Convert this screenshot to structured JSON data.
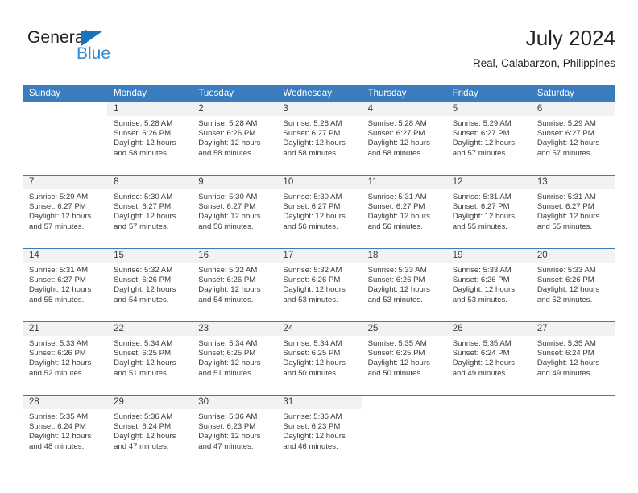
{
  "brand": {
    "name_part1": "General",
    "name_part2": "Blue",
    "triangle_icon": "triangle-icon",
    "accent_color": "#2e8bd4",
    "triangle_color": "#1a74bb"
  },
  "header": {
    "month_title": "July 2024",
    "location": "Real, Calabarzon, Philippines"
  },
  "theme": {
    "header_bar_color": "#3a7cbe",
    "daynum_strip_color": "#f2f2f2",
    "text_color": "#3b3b3b"
  },
  "calendar": {
    "weekday_headers": [
      "Sunday",
      "Monday",
      "Tuesday",
      "Wednesday",
      "Thursday",
      "Friday",
      "Saturday"
    ],
    "weeks": [
      [
        {
          "day": "",
          "sunrise": "",
          "sunset": "",
          "daylight_line1": "",
          "daylight_line2": ""
        },
        {
          "day": "1",
          "sunrise": "Sunrise: 5:28 AM",
          "sunset": "Sunset: 6:26 PM",
          "daylight_line1": "Daylight: 12 hours",
          "daylight_line2": "and 58 minutes."
        },
        {
          "day": "2",
          "sunrise": "Sunrise: 5:28 AM",
          "sunset": "Sunset: 6:26 PM",
          "daylight_line1": "Daylight: 12 hours",
          "daylight_line2": "and 58 minutes."
        },
        {
          "day": "3",
          "sunrise": "Sunrise: 5:28 AM",
          "sunset": "Sunset: 6:27 PM",
          "daylight_line1": "Daylight: 12 hours",
          "daylight_line2": "and 58 minutes."
        },
        {
          "day": "4",
          "sunrise": "Sunrise: 5:28 AM",
          "sunset": "Sunset: 6:27 PM",
          "daylight_line1": "Daylight: 12 hours",
          "daylight_line2": "and 58 minutes."
        },
        {
          "day": "5",
          "sunrise": "Sunrise: 5:29 AM",
          "sunset": "Sunset: 6:27 PM",
          "daylight_line1": "Daylight: 12 hours",
          "daylight_line2": "and 57 minutes."
        },
        {
          "day": "6",
          "sunrise": "Sunrise: 5:29 AM",
          "sunset": "Sunset: 6:27 PM",
          "daylight_line1": "Daylight: 12 hours",
          "daylight_line2": "and 57 minutes."
        }
      ],
      [
        {
          "day": "7",
          "sunrise": "Sunrise: 5:29 AM",
          "sunset": "Sunset: 6:27 PM",
          "daylight_line1": "Daylight: 12 hours",
          "daylight_line2": "and 57 minutes."
        },
        {
          "day": "8",
          "sunrise": "Sunrise: 5:30 AM",
          "sunset": "Sunset: 6:27 PM",
          "daylight_line1": "Daylight: 12 hours",
          "daylight_line2": "and 57 minutes."
        },
        {
          "day": "9",
          "sunrise": "Sunrise: 5:30 AM",
          "sunset": "Sunset: 6:27 PM",
          "daylight_line1": "Daylight: 12 hours",
          "daylight_line2": "and 56 minutes."
        },
        {
          "day": "10",
          "sunrise": "Sunrise: 5:30 AM",
          "sunset": "Sunset: 6:27 PM",
          "daylight_line1": "Daylight: 12 hours",
          "daylight_line2": "and 56 minutes."
        },
        {
          "day": "11",
          "sunrise": "Sunrise: 5:31 AM",
          "sunset": "Sunset: 6:27 PM",
          "daylight_line1": "Daylight: 12 hours",
          "daylight_line2": "and 56 minutes."
        },
        {
          "day": "12",
          "sunrise": "Sunrise: 5:31 AM",
          "sunset": "Sunset: 6:27 PM",
          "daylight_line1": "Daylight: 12 hours",
          "daylight_line2": "and 55 minutes."
        },
        {
          "day": "13",
          "sunrise": "Sunrise: 5:31 AM",
          "sunset": "Sunset: 6:27 PM",
          "daylight_line1": "Daylight: 12 hours",
          "daylight_line2": "and 55 minutes."
        }
      ],
      [
        {
          "day": "14",
          "sunrise": "Sunrise: 5:31 AM",
          "sunset": "Sunset: 6:27 PM",
          "daylight_line1": "Daylight: 12 hours",
          "daylight_line2": "and 55 minutes."
        },
        {
          "day": "15",
          "sunrise": "Sunrise: 5:32 AM",
          "sunset": "Sunset: 6:26 PM",
          "daylight_line1": "Daylight: 12 hours",
          "daylight_line2": "and 54 minutes."
        },
        {
          "day": "16",
          "sunrise": "Sunrise: 5:32 AM",
          "sunset": "Sunset: 6:26 PM",
          "daylight_line1": "Daylight: 12 hours",
          "daylight_line2": "and 54 minutes."
        },
        {
          "day": "17",
          "sunrise": "Sunrise: 5:32 AM",
          "sunset": "Sunset: 6:26 PM",
          "daylight_line1": "Daylight: 12 hours",
          "daylight_line2": "and 53 minutes."
        },
        {
          "day": "18",
          "sunrise": "Sunrise: 5:33 AM",
          "sunset": "Sunset: 6:26 PM",
          "daylight_line1": "Daylight: 12 hours",
          "daylight_line2": "and 53 minutes."
        },
        {
          "day": "19",
          "sunrise": "Sunrise: 5:33 AM",
          "sunset": "Sunset: 6:26 PM",
          "daylight_line1": "Daylight: 12 hours",
          "daylight_line2": "and 53 minutes."
        },
        {
          "day": "20",
          "sunrise": "Sunrise: 5:33 AM",
          "sunset": "Sunset: 6:26 PM",
          "daylight_line1": "Daylight: 12 hours",
          "daylight_line2": "and 52 minutes."
        }
      ],
      [
        {
          "day": "21",
          "sunrise": "Sunrise: 5:33 AM",
          "sunset": "Sunset: 6:26 PM",
          "daylight_line1": "Daylight: 12 hours",
          "daylight_line2": "and 52 minutes."
        },
        {
          "day": "22",
          "sunrise": "Sunrise: 5:34 AM",
          "sunset": "Sunset: 6:25 PM",
          "daylight_line1": "Daylight: 12 hours",
          "daylight_line2": "and 51 minutes."
        },
        {
          "day": "23",
          "sunrise": "Sunrise: 5:34 AM",
          "sunset": "Sunset: 6:25 PM",
          "daylight_line1": "Daylight: 12 hours",
          "daylight_line2": "and 51 minutes."
        },
        {
          "day": "24",
          "sunrise": "Sunrise: 5:34 AM",
          "sunset": "Sunset: 6:25 PM",
          "daylight_line1": "Daylight: 12 hours",
          "daylight_line2": "and 50 minutes."
        },
        {
          "day": "25",
          "sunrise": "Sunrise: 5:35 AM",
          "sunset": "Sunset: 6:25 PM",
          "daylight_line1": "Daylight: 12 hours",
          "daylight_line2": "and 50 minutes."
        },
        {
          "day": "26",
          "sunrise": "Sunrise: 5:35 AM",
          "sunset": "Sunset: 6:24 PM",
          "daylight_line1": "Daylight: 12 hours",
          "daylight_line2": "and 49 minutes."
        },
        {
          "day": "27",
          "sunrise": "Sunrise: 5:35 AM",
          "sunset": "Sunset: 6:24 PM",
          "daylight_line1": "Daylight: 12 hours",
          "daylight_line2": "and 49 minutes."
        }
      ],
      [
        {
          "day": "28",
          "sunrise": "Sunrise: 5:35 AM",
          "sunset": "Sunset: 6:24 PM",
          "daylight_line1": "Daylight: 12 hours",
          "daylight_line2": "and 48 minutes."
        },
        {
          "day": "29",
          "sunrise": "Sunrise: 5:36 AM",
          "sunset": "Sunset: 6:24 PM",
          "daylight_line1": "Daylight: 12 hours",
          "daylight_line2": "and 47 minutes."
        },
        {
          "day": "30",
          "sunrise": "Sunrise: 5:36 AM",
          "sunset": "Sunset: 6:23 PM",
          "daylight_line1": "Daylight: 12 hours",
          "daylight_line2": "and 47 minutes."
        },
        {
          "day": "31",
          "sunrise": "Sunrise: 5:36 AM",
          "sunset": "Sunset: 6:23 PM",
          "daylight_line1": "Daylight: 12 hours",
          "daylight_line2": "and 46 minutes."
        },
        {
          "day": "",
          "sunrise": "",
          "sunset": "",
          "daylight_line1": "",
          "daylight_line2": ""
        },
        {
          "day": "",
          "sunrise": "",
          "sunset": "",
          "daylight_line1": "",
          "daylight_line2": ""
        },
        {
          "day": "",
          "sunrise": "",
          "sunset": "",
          "daylight_line1": "",
          "daylight_line2": ""
        }
      ]
    ]
  }
}
